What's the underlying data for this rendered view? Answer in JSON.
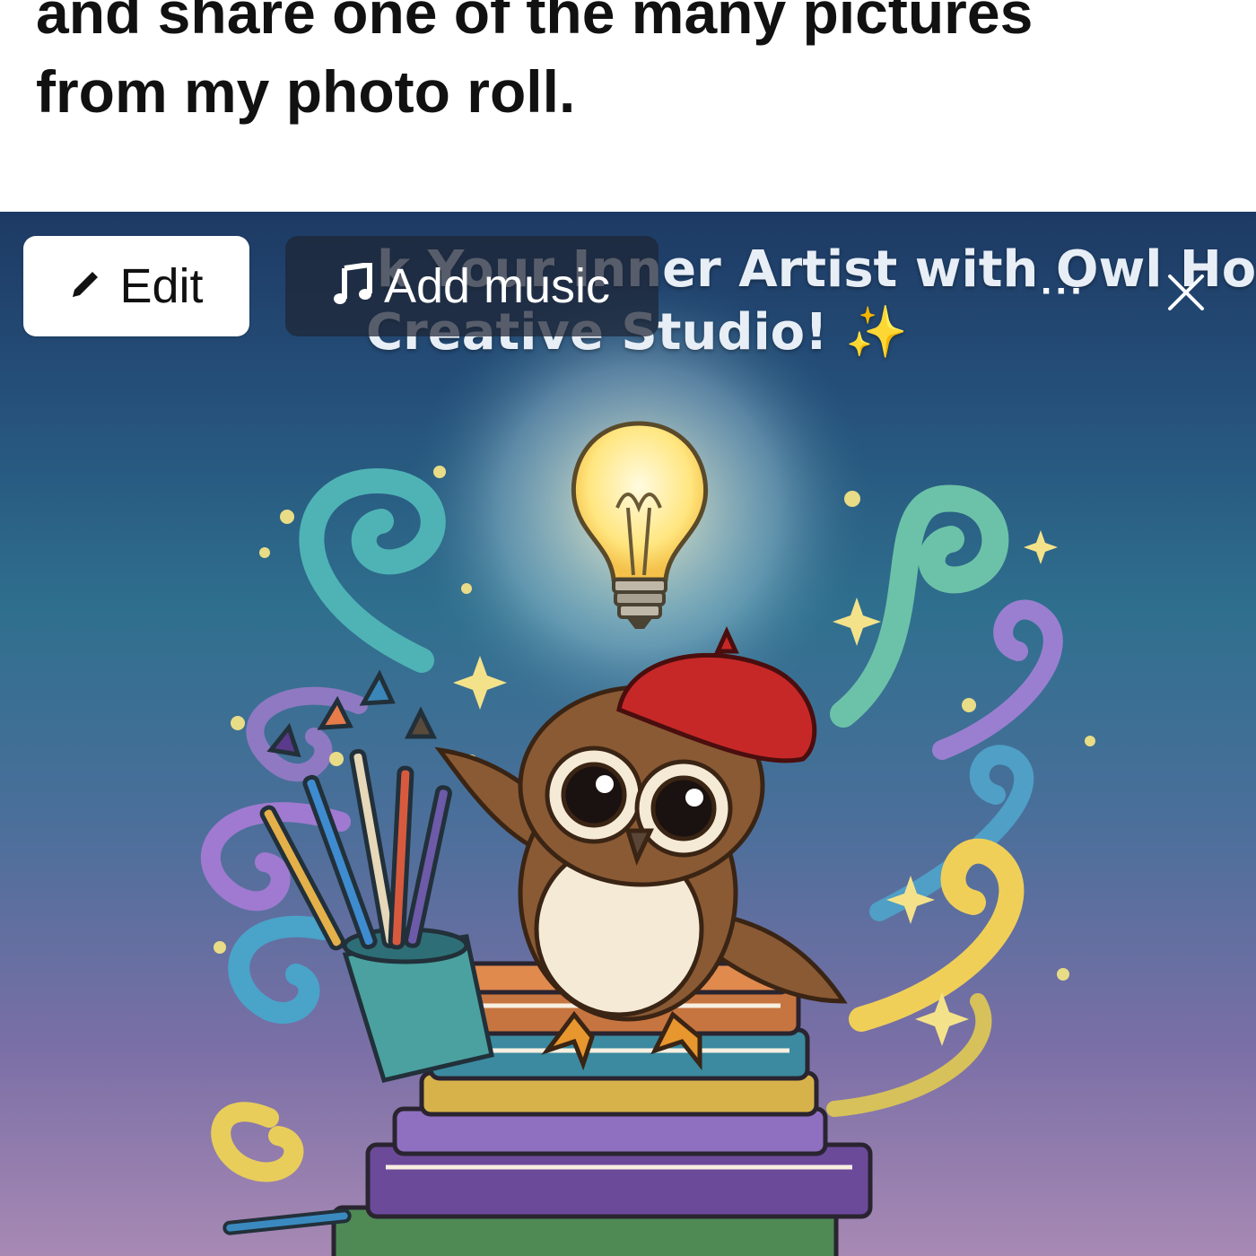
{
  "post": {
    "line1": "and share one of the many pictures",
    "line2": "from my photo roll."
  },
  "photo": {
    "caption_line1": "k Your Inner Artist with Owl Hour",
    "caption_line2": "Creative Studio! ✨"
  },
  "controls": {
    "edit_label": "Edit",
    "music_label": "Add music",
    "more_glyph": "···",
    "close_glyph": "✕"
  },
  "icons": {
    "edit": "pencil-icon",
    "music": "music-note-icon",
    "more": "more-icon",
    "close": "close-icon"
  },
  "colors": {
    "sky_top": "#1d3a64",
    "sky_bottom": "#a889b4",
    "beret": "#c62828",
    "owl": "#8a5a34"
  }
}
